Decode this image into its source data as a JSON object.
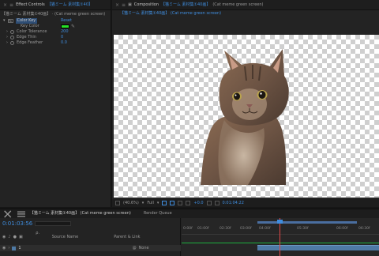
{
  "effect_controls": {
    "tab_close": "×",
    "tab_title": "Effect Controls",
    "tab_source": "【猫ミーム 素材集①40】",
    "source_line": "【猫ミーム 素材集①40画】 · (Cat meme green screen)",
    "effect_name": "Color Key",
    "reset_label": "Reset",
    "properties": [
      {
        "name": "Key Color",
        "value": ""
      },
      {
        "name": "Color Tolerance",
        "value": "200"
      },
      {
        "name": "Edge Thin",
        "value": "0"
      },
      {
        "name": "Edge Feather",
        "value": "0.0"
      }
    ],
    "key_color_hex": "#27e227"
  },
  "composition": {
    "tab_title": "Composition",
    "tab_source": "【猫ミーム 素材集①40画】",
    "tab_suffix": "(Cat meme green screen)",
    "breadcrumb": "【猫ミーム 素材集①40画】 (Cat meme green screen)",
    "zoom": "(40.6%)",
    "resolution": "Full",
    "exposure": "+0.0",
    "timecode": "0:01:04:22"
  },
  "timeline": {
    "tab_title": "【猫ミーム 素材集①40画】 (Cat meme green screen)",
    "render_queue": "Render Queue",
    "current_time": "0:01:03:56",
    "search_placeholder": "ρ.",
    "col_source": "Source Name",
    "col_parent": "Parent & Link",
    "layer_index": "1",
    "layer_parent": "None",
    "ruler_ticks": [
      "0:00f",
      "01:00f",
      "02:30f",
      "03:00f",
      "04:00f",
      "05:30f",
      "06:00f",
      "06:30f"
    ]
  },
  "colors": {
    "accent": "#3f8dde",
    "timeline_layer": "#4e7aa5",
    "playhead": "#e34848"
  }
}
